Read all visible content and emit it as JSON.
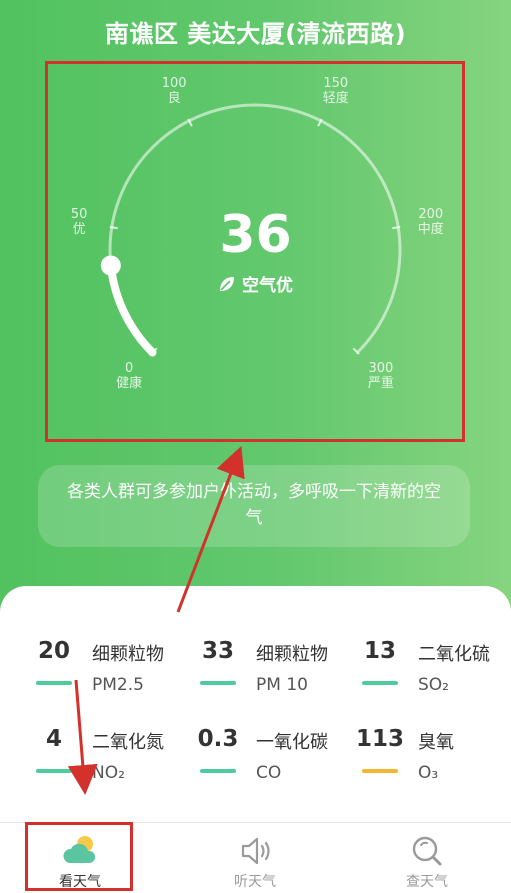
{
  "location": "南谯区 美达大厦(清流西路)",
  "aqi": {
    "value": "36",
    "level": "空气优",
    "scale": {
      "min": 0,
      "max": 300,
      "current": 36,
      "ticks": [
        {
          "value": "0",
          "label": "健康"
        },
        {
          "value": "50",
          "label": "优"
        },
        {
          "value": "100",
          "label": "良"
        },
        {
          "value": "150",
          "label": "轻度"
        },
        {
          "value": "200",
          "label": "中度"
        },
        {
          "value": "300",
          "label": "严重"
        }
      ]
    }
  },
  "advice": "各类人群可多参加户外活动，多呼吸一下清新的空气",
  "pollutants": [
    {
      "value": "20",
      "name": "细颗粒物",
      "code": "PM2.5",
      "bar_color": "#4ecb9d"
    },
    {
      "value": "33",
      "name": "细颗粒物",
      "code": "PM 10",
      "bar_color": "#4ecb9d"
    },
    {
      "value": "13",
      "name": "二氧化硫",
      "code": "SO₂",
      "bar_color": "#4ecb9d"
    },
    {
      "value": "4",
      "name": "二氧化氮",
      "code": "NO₂",
      "bar_color": "#4ecb9d"
    },
    {
      "value": "0.3",
      "name": "一氧化碳",
      "code": "CO",
      "bar_color": "#4ecb9d"
    },
    {
      "value": "113",
      "name": "臭氧",
      "code": "O₃",
      "bar_color": "#f5b731"
    }
  ],
  "tabs": [
    {
      "label": "看天气",
      "icon": "cloud-sun-icon",
      "active": true
    },
    {
      "label": "听天气",
      "icon": "speaker-icon",
      "active": false
    },
    {
      "label": "查天气",
      "icon": "magnifier-icon",
      "active": false
    }
  ],
  "colors": {
    "accent_green": "#51c25f",
    "annotation_red": "#d3322c",
    "active_tab": "#333333",
    "inactive_tab": "#9a9a9a"
  }
}
